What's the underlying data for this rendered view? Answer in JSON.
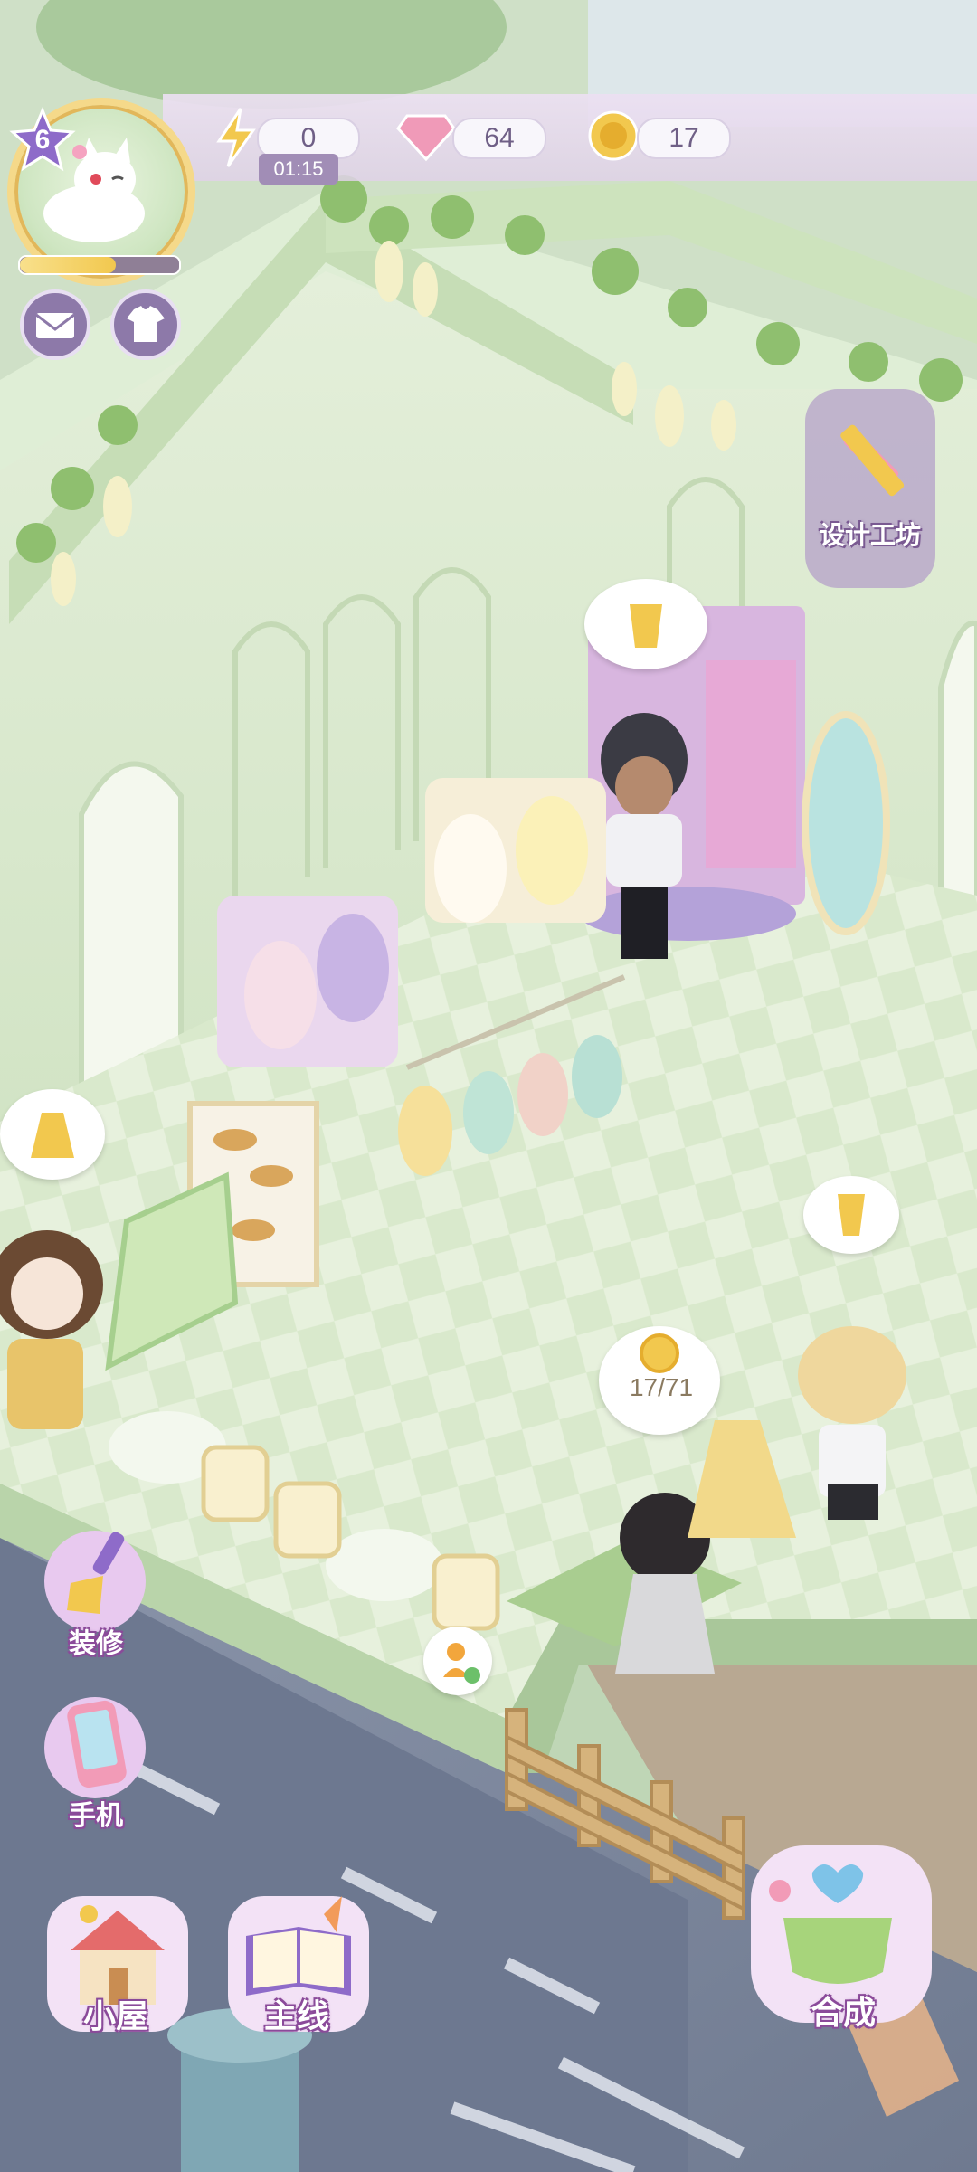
{
  "player": {
    "level": "6"
  },
  "resources": {
    "energy": "0",
    "energy_timer": "01:15",
    "gems": "64",
    "coins": "17"
  },
  "top_buttons": {
    "mail_icon": "mail-icon",
    "outfit_icon": "shirt-icon"
  },
  "right_menu": {
    "design_workshop": "设计工坊"
  },
  "shop": {
    "coin_progress": "17/71"
  },
  "left_menu": {
    "decorate": "装修",
    "phone": "手机"
  },
  "bottom_menu": {
    "house": "小屋",
    "main_story": "主线",
    "merge": "合成"
  },
  "colors": {
    "hud_purple": "#a18db6",
    "accent_gold": "#f2c84e",
    "label_outline": "#8b4b9a",
    "wall_green": "#dbe9d0",
    "floor_green": "#e6f0dd",
    "road_grey": "#7f8aa0"
  }
}
